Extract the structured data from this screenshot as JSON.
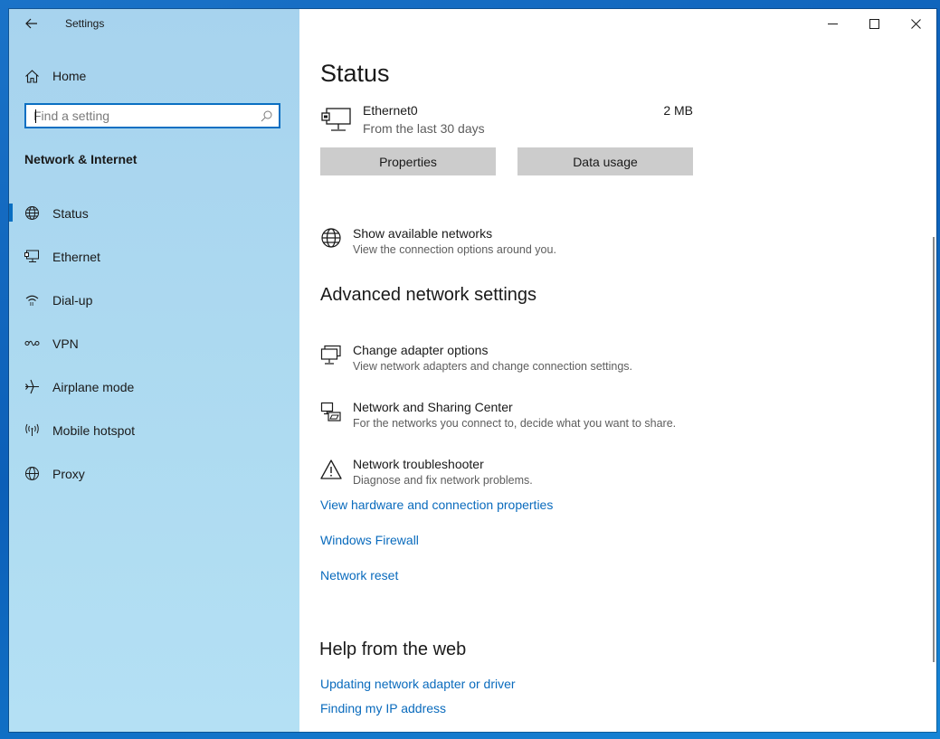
{
  "window": {
    "title": "Settings"
  },
  "sidebar": {
    "home_label": "Home",
    "search": {
      "placeholder": "Find a setting",
      "value": ""
    },
    "section_title": "Network & Internet",
    "items": [
      {
        "label": "Status",
        "icon": "status-globe-icon",
        "selected": true
      },
      {
        "label": "Ethernet",
        "icon": "ethernet-icon",
        "selected": false
      },
      {
        "label": "Dial-up",
        "icon": "dial-up-icon",
        "selected": false
      },
      {
        "label": "VPN",
        "icon": "vpn-icon",
        "selected": false
      },
      {
        "label": "Airplane mode",
        "icon": "airplane-icon",
        "selected": false
      },
      {
        "label": "Mobile hotspot",
        "icon": "hotspot-icon",
        "selected": false
      },
      {
        "label": "Proxy",
        "icon": "globe-icon",
        "selected": false
      }
    ]
  },
  "main": {
    "title": "Status",
    "connection": {
      "name": "Ethernet0",
      "period": "From the last 30 days",
      "usage": "2 MB"
    },
    "buttons": {
      "properties": "Properties",
      "data_usage": "Data usage"
    },
    "show_networks": {
      "title": "Show available networks",
      "desc": "View the connection options around you."
    },
    "advanced_heading": "Advanced network settings",
    "advanced_items": [
      {
        "title": "Change adapter options",
        "desc": "View network adapters and change connection settings.",
        "icon": "adapter-icon"
      },
      {
        "title": "Network and Sharing Center",
        "desc": "For the networks you connect to, decide what you want to share.",
        "icon": "sharing-center-icon"
      },
      {
        "title": "Network troubleshooter",
        "desc": "Diagnose and fix network problems.",
        "icon": "warning-icon"
      }
    ],
    "links": {
      "hardware": "View hardware and connection properties",
      "firewall": "Windows Firewall",
      "reset": "Network reset"
    },
    "help_heading": "Help from the web",
    "help_links": {
      "adapter_driver": "Updating network adapter or driver",
      "ip_address": "Finding my IP address"
    }
  },
  "colors": {
    "accent": "#0a6fc2",
    "link": "#0a6bbd",
    "sidebar_bg": "#aad7f0"
  }
}
